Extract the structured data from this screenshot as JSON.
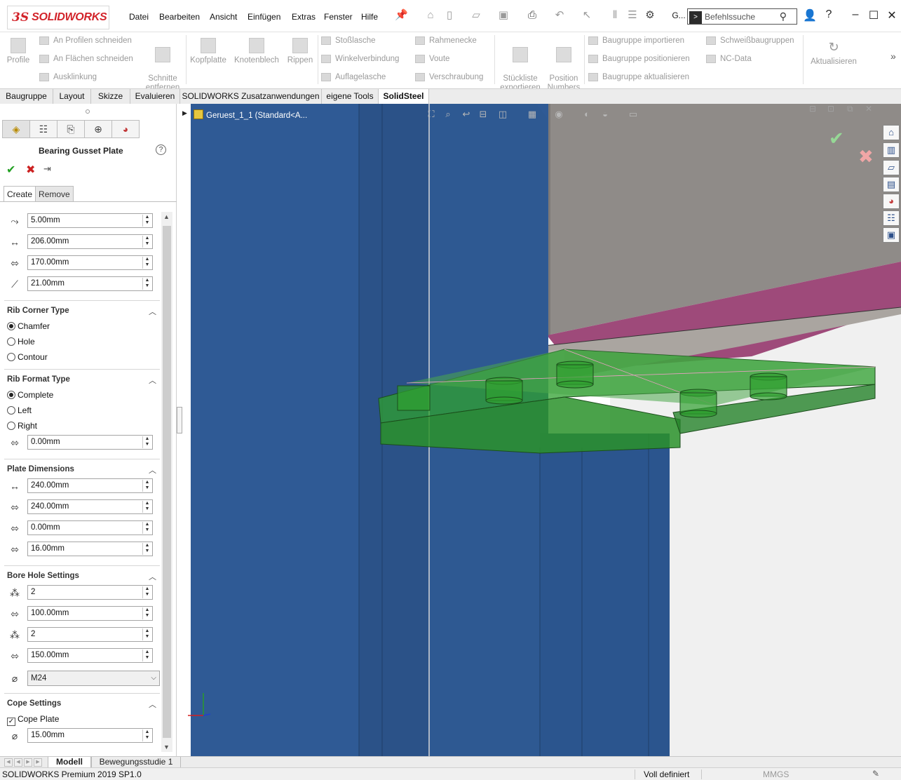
{
  "app": {
    "brand_ds": "3S",
    "brand_name": "SOLIDWORKS"
  },
  "menu": [
    "Datei",
    "Bearbeiten",
    "Ansicht",
    "Einfügen",
    "Extras",
    "Fenster",
    "Hilfe"
  ],
  "toolbar": {
    "doc_abbrev": "G...",
    "search_placeholder": "Befehlssuche"
  },
  "command_manager": {
    "profile_label": "Profile",
    "group1": [
      "An Profilen schneiden",
      "An Flächen schneiden",
      "Ausklinkung"
    ],
    "schnitte_label": "Schnitte\nentfernen",
    "big2": [
      "Kopfplatte",
      "Knotenblech",
      "Rippen"
    ],
    "group3": [
      "Stoßlasche",
      "Winkelverbindung",
      "Auflagelasche"
    ],
    "group4": [
      "Rahmenecke",
      "Voute",
      "Verschraubung"
    ],
    "stueckliste_label": "Stückliste\nexportieren",
    "position_label": "Position\nNumbers",
    "group5": [
      "Baugruppe importieren",
      "Baugruppe positionieren",
      "Baugruppe aktualisieren"
    ],
    "group6": [
      "Schweißbaugruppen",
      "NC-Data"
    ],
    "aktualisieren_label": "Aktualisieren",
    "more": "»"
  },
  "tabs": [
    "Baugruppe",
    "Layout",
    "Skizze",
    "Evaluieren",
    "SOLIDWORKS Zusatzanwendungen",
    "eigene Tools",
    "SolidSteel"
  ],
  "active_tab": "SolidSteel",
  "property_manager": {
    "title": "Bearing Gusset Plate",
    "help": "?",
    "create_tab": "Create",
    "remove_tab": "Remove",
    "top_fields": [
      "5.00mm",
      "206.00mm",
      "170.00mm",
      "21.00mm"
    ],
    "rib_corner": {
      "heading": "Rib Corner Type",
      "options": [
        "Chamfer",
        "Hole",
        "Contour"
      ],
      "selected": "Chamfer"
    },
    "rib_format": {
      "heading": "Rib Format Type",
      "options": [
        "Complete",
        "Left",
        "Right"
      ],
      "selected": "Complete",
      "value": "0.00mm"
    },
    "plate_dimensions": {
      "heading": "Plate Dimensions",
      "values": [
        "240.00mm",
        "240.00mm",
        "0.00mm",
        "16.00mm"
      ]
    },
    "bore_hole": {
      "heading": "Bore Hole Settings",
      "values": [
        "2",
        "100.00mm",
        "2",
        "150.00mm"
      ],
      "bolt_size": "M24"
    },
    "cope": {
      "heading": "Cope Settings",
      "cope_plate_label": "Cope Plate",
      "cope_plate_checked": true,
      "value": "15.00mm"
    }
  },
  "viewport": {
    "tree_node": "Geruest_1_1  (Standard<A...",
    "colors": {
      "beam_blue": "#2f5a95",
      "plate_green": "#2fa02f",
      "flange_grey": "#a8a39e",
      "magenta": "#9e4a7a"
    }
  },
  "bottom_tabs": [
    "Modell",
    "Bewegungsstudie 1"
  ],
  "status": {
    "version": "SOLIDWORKS Premium 2019 SP1.0",
    "state": "Voll definiert",
    "units": "MMGS"
  }
}
